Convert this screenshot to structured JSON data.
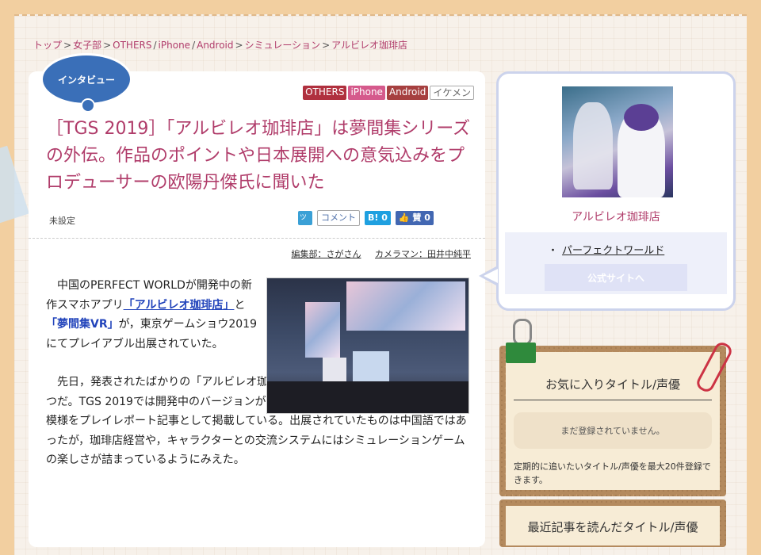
{
  "breadcrumb": [
    "トップ",
    "女子部",
    "OTHERS",
    "iPhone",
    "Android",
    "シミュレーション",
    "アルビレオ珈琲店"
  ],
  "breadcrumb_separators": [
    ">",
    ">",
    "/",
    "/",
    ">",
    ">"
  ],
  "category_badge": "インタビュー",
  "tags": [
    "OTHERS",
    "iPhone",
    "Android",
    "イケメン"
  ],
  "article": {
    "title": "［TGS 2019］「アルビレオ珈琲店」は夢間集シリーズの外伝。作品のポイントや日本展開への意気込みをプロデューサーの欧陽丹傑氏に聞いた",
    "unset_label": "未設定",
    "credits": {
      "editor": "編集部：さがさん",
      "camera": "カメラマン：田井中純平"
    },
    "p1_a": "中国のPERFECT WORLDが開発中の新作スマホアプリ",
    "p1_link1": "「アルビレオ珈琲店」",
    "p1_b": "と",
    "p1_link2": "「夢間集VR」",
    "p1_c": "が，東京ゲームショウ2019にてプレイアブル出展されていた。",
    "p2": "先日，発表されたばかりの「アルビレオ珈琲店」は，同社の夢間集シリーズのひとつだ。TGS 2019では開発中のバージョンがプレイアブル出展されており，その体験模様をプレイレポート記事として掲載している。出展されていたものは中国語ではあったが，珈琲店経営や，キャラクターとの交流システムにはシミュレーションゲームの楽しさが詰まっているようにみえた。"
  },
  "share": {
    "tweet": "ツイート",
    "comment": "コメント",
    "hatena": "B! 0",
    "like": "👍 賛 0"
  },
  "sidebar": {
    "game_name": "アルビレオ珈琲店",
    "publisher": "パーフェクトワールド",
    "official_button": "公式サイトへ",
    "favorites_title": "お気に入りタイトル/声優",
    "favorites_empty": "まだ登録されていません。",
    "favorites_note": "定期的に追いたいタイトル/声優を最大20件登録できます。",
    "recent_title": "最近記事を読んだタイトル/声優"
  }
}
